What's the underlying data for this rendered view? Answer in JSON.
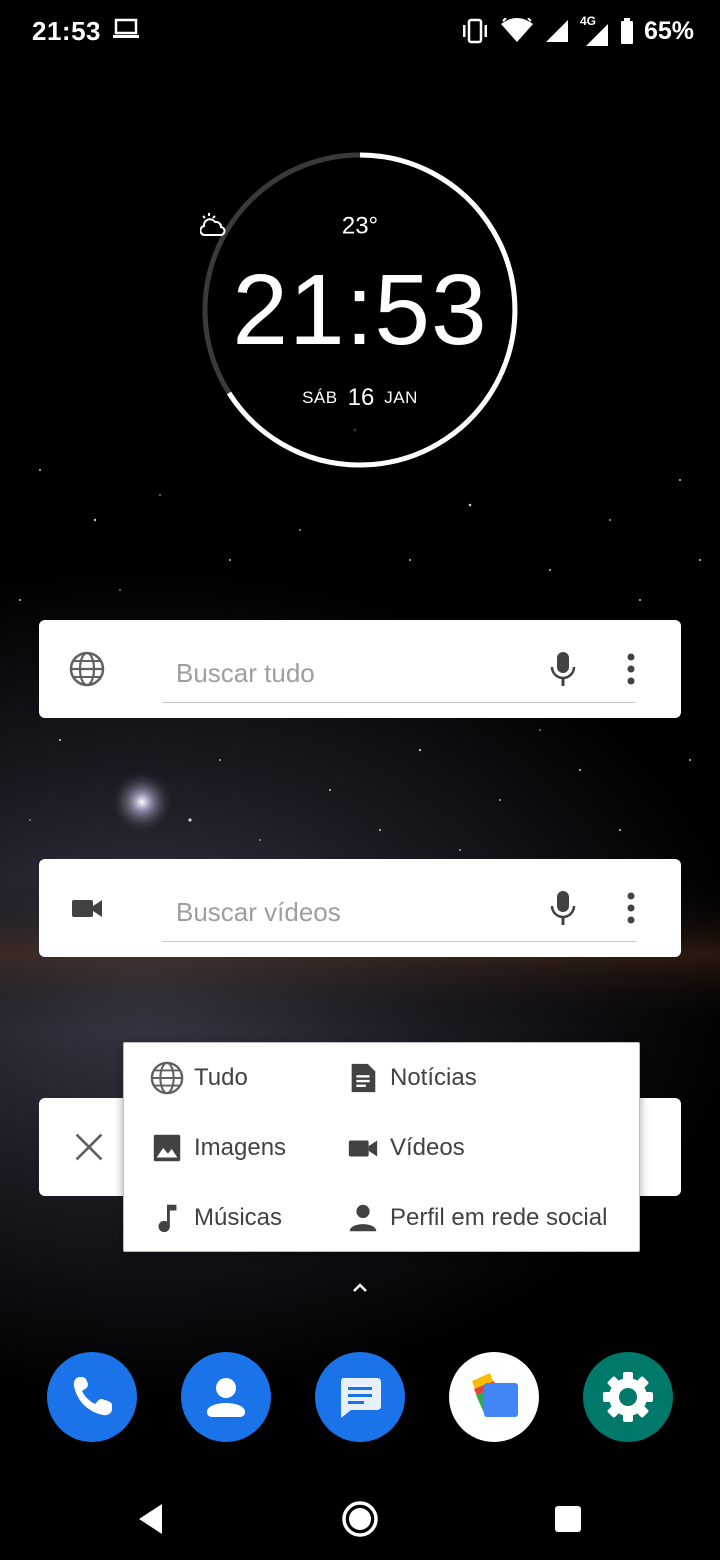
{
  "status_bar": {
    "time": "21:53",
    "network_label": "4G",
    "battery": "65%",
    "icons": [
      "laptop-icon",
      "vibrate-icon",
      "wifi-icon",
      "signal-icon",
      "signal-4g-icon",
      "battery-icon"
    ]
  },
  "clock_widget": {
    "weather_icon": "partly-cloudy-night-icon",
    "temperature": "23°",
    "time": "21:53",
    "day_of_week": "SÁB",
    "day": "16",
    "month": "JAN"
  },
  "search_all": {
    "icon": "globe-icon",
    "placeholder": "Buscar tudo"
  },
  "search_videos": {
    "icon": "videocam-icon",
    "placeholder": "Buscar vídeos"
  },
  "search_third": {
    "icon": "close-icon"
  },
  "popup_menu": {
    "options": [
      {
        "label": "Tudo",
        "icon": "globe-icon"
      },
      {
        "label": "Notícias",
        "icon": "article-icon"
      },
      {
        "label": "Imagens",
        "icon": "image-icon"
      },
      {
        "label": "Vídeos",
        "icon": "videocam-icon"
      },
      {
        "label": "Músicas",
        "icon": "music-note-icon"
      },
      {
        "label": "Perfil em rede social",
        "icon": "person-icon"
      }
    ]
  },
  "dock": {
    "apps": [
      "phone-icon",
      "contacts-icon",
      "messages-icon",
      "files-icon",
      "settings-icon"
    ],
    "colors": {
      "blue": "#1a73e8",
      "settings_teal": "#00796b",
      "files_bg": "#ffffff"
    }
  },
  "nav_bar": [
    "back-icon",
    "home-icon",
    "recents-icon"
  ]
}
